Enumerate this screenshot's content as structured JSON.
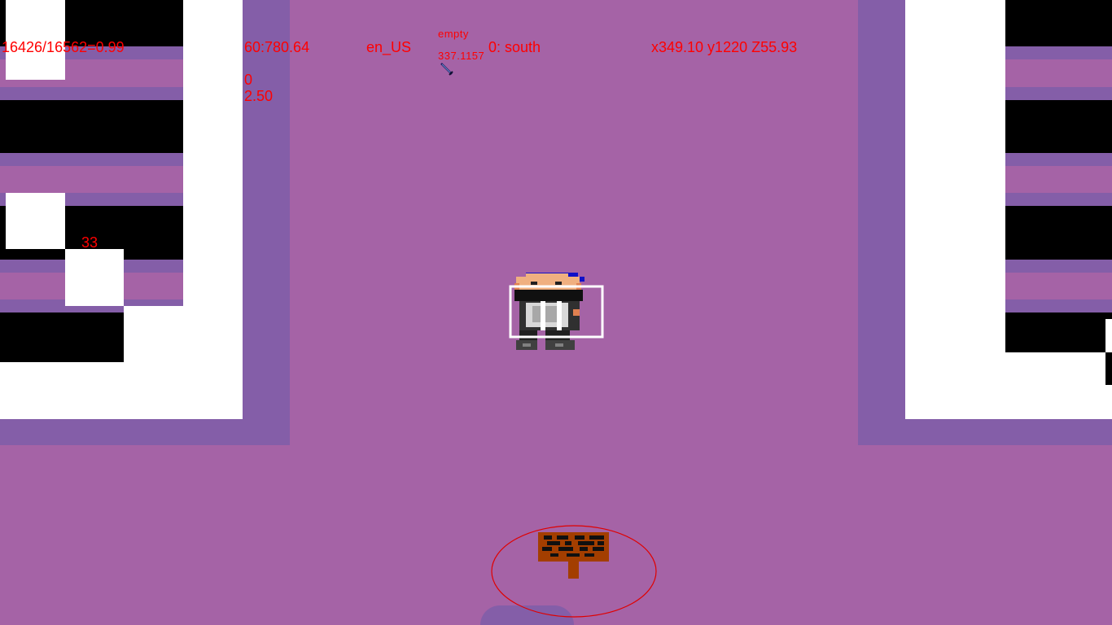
{
  "hud": {
    "frame_counter": "16426/16562=0.99",
    "timer": "60:780.64",
    "locale": "en_US",
    "status": "empty",
    "status_value": "337.1157",
    "direction": "0: south",
    "position": "x349.10 y1220 Z55.93",
    "stat_a": "0",
    "stat_b": "2.50",
    "entity_label": "33"
  },
  "colors": {
    "floor": "#a563a6",
    "wall_shadow": "#845ea8",
    "hud_text": "#ff0000",
    "sign_wood": "#a33e00"
  },
  "icons": {
    "cursor": "sword-cursor-icon",
    "player": "player-character-sprite",
    "sign": "wooden-signpost-sprite"
  }
}
